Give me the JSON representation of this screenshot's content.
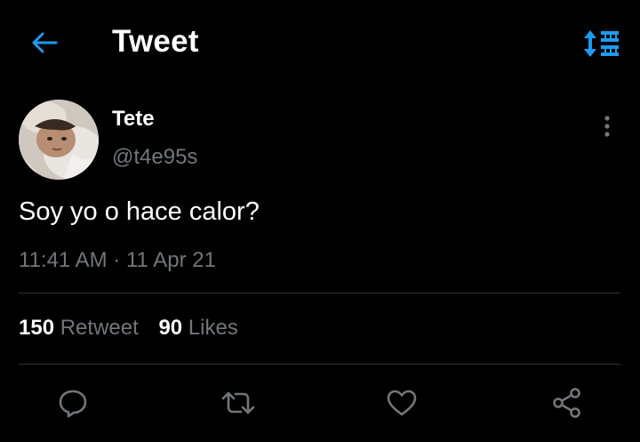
{
  "header": {
    "title": "Tweet",
    "back_icon": "arrow-left-icon",
    "sort_icon": "sort-list-icon",
    "accent_color": "#1d9bf0"
  },
  "tweet": {
    "author": {
      "display_name": "Tete",
      "handle": "@t4e95s",
      "avatar_icon": "profile-photo"
    },
    "text": "Soy yo o hace calor?",
    "time": "11:41 AM",
    "separator": " · ",
    "date": "11 Apr 21",
    "more_icon": "more-vertical-icon"
  },
  "stats": {
    "retweets_count": "150",
    "retweets_label": "Retweet",
    "likes_count": "90",
    "likes_label": "Likes"
  },
  "actions": [
    {
      "icon": "reply-icon"
    },
    {
      "icon": "retweet-icon"
    },
    {
      "icon": "like-heart-icon"
    },
    {
      "icon": "share-icon"
    }
  ],
  "colors": {
    "background": "#000000",
    "text_primary": "#ffffff",
    "text_secondary": "#71767b",
    "divider": "#2f3336"
  }
}
